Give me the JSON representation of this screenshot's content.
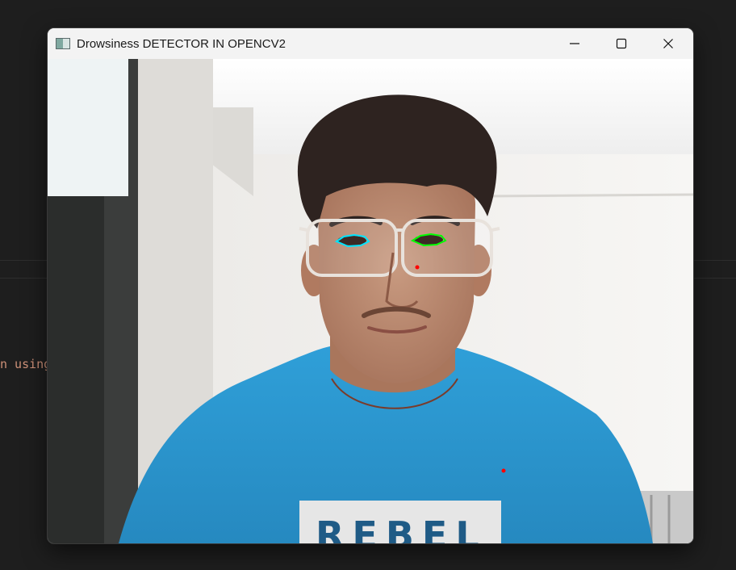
{
  "window": {
    "title": "Drowsiness DETECTOR IN OPENCV2",
    "icon": "opencv-window-icon",
    "controls": {
      "minimize_icon": "minimize-icon",
      "maximize_icon": "maximize-icon",
      "close_icon": "close-icon"
    }
  },
  "background_editor": {
    "code_fragment": "n using"
  },
  "overlay": {
    "left_eye_color": "#00e5ff",
    "right_eye_color": "#00ff00",
    "marker_color": "#ff0000"
  },
  "shirt_text": "REBEL",
  "colors": {
    "desktop_bg": "#1e1e1e",
    "titlebar_bg": "#f3f3f3",
    "shirt": "#2e9ad3"
  }
}
